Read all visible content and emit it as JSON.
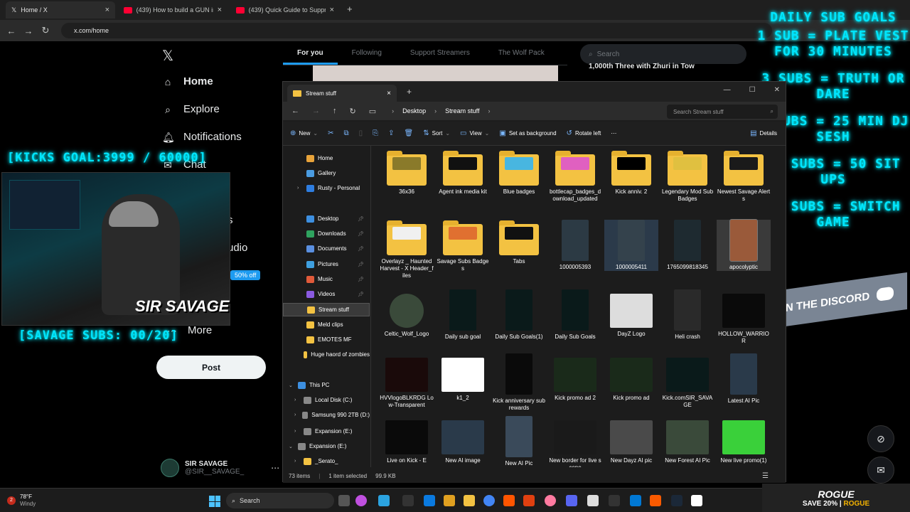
{
  "browser": {
    "tabs": [
      {
        "title": "Home / X",
        "active": true
      },
      {
        "title": "(439) How to build a GUN in g",
        "active": false
      },
      {
        "title": "(439) Quick Guide to Suppress",
        "active": false
      }
    ],
    "new_tab": "+",
    "url": "x.com/home"
  },
  "x": {
    "nav": [
      {
        "label": "Home",
        "icon": "home-icon"
      },
      {
        "label": "Explore",
        "icon": "search-icon"
      },
      {
        "label": "Notifications",
        "icon": "bell-icon"
      },
      {
        "label": "Chat",
        "icon": "mail-icon"
      },
      {
        "label": "More",
        "icon": "more-icon"
      }
    ],
    "nav_partial_1": "s",
    "nav_partial_2": "udio",
    "post_label": "Post",
    "discount": "50% off",
    "profile": {
      "name": "SIR SAVAGE",
      "handle": "@SIR__SAVAGE_"
    },
    "feed_tabs": [
      "For you",
      "Following",
      "Support Streamers",
      "The Wolf Pack"
    ],
    "search_placeholder": "Search",
    "trend_title": "1,000th Three with Zhuri in Tow"
  },
  "overlay": {
    "goals": [
      "DAILY SUB GOALS",
      "1 SUB = PLATE VEST FOR 30 MINUTES",
      "3 SUBS = TRUTH OR DARE",
      "5 SUBS = 25 MIN DJ SESH",
      "10 SUBS = 50 SIT UPS",
      "20 SUBS = SWITCH GAME"
    ],
    "kicks_goal": "[KICKS GOAL:3999 / 60000]",
    "savage_subs": "[SAVAGE SUBS: 00/20]",
    "cam_name": "SIR SAVAGE",
    "discord": "JOIN THE DISCORD",
    "rogue": "ROGUE",
    "rogue_save": "SAVE 20%",
    "rogue_code": "ROGUE"
  },
  "explorer": {
    "tab_title": "Stream stuff",
    "breadcrumb": [
      "Desktop",
      "Stream stuff"
    ],
    "search_placeholder": "Search Stream stuff",
    "toolbar": [
      "New",
      "Sort",
      "View",
      "Set as background",
      "Rotate left",
      "Details"
    ],
    "nav": [
      {
        "label": "Home",
        "color": "#e8a33a"
      },
      {
        "label": "Gallery",
        "color": "#4a9be0"
      },
      {
        "label": "Rusty - Personal",
        "color": "#2e7de0"
      },
      {
        "label": "Desktop",
        "color": "#3d8fe0"
      },
      {
        "label": "Downloads",
        "color": "#2fa35f"
      },
      {
        "label": "Documents",
        "color": "#5a8fe0"
      },
      {
        "label": "Pictures",
        "color": "#3fa0e0"
      },
      {
        "label": "Music",
        "color": "#e05a3a"
      },
      {
        "label": "Videos",
        "color": "#8a5ae0"
      },
      {
        "label": "Stream stuff",
        "color": "#f3c242"
      },
      {
        "label": "Meld clips",
        "color": "#f3c242"
      },
      {
        "label": "EMOTES MF",
        "color": "#f3c242"
      },
      {
        "label": "Huge haord of zombies",
        "color": "#f3c242"
      },
      {
        "label": "This PC",
        "color": "#3d8fe0"
      },
      {
        "label": "Local Disk (C:)",
        "color": "#888888"
      },
      {
        "label": "Samsung 990 2TB (D:)",
        "color": "#888888"
      },
      {
        "label": "Expansion (E:)",
        "color": "#888888"
      },
      {
        "label": "Expansion (E:)",
        "color": "#888888"
      },
      {
        "label": "_Serato_",
        "color": "#f3c242"
      }
    ],
    "files": [
      {
        "name": "36x36",
        "kind": "folder",
        "color": "#8a7a2a"
      },
      {
        "name": "Agent ink media kit",
        "kind": "folder",
        "color": "#111111"
      },
      {
        "name": "Blue badges",
        "kind": "folder",
        "color": "#48b6e0"
      },
      {
        "name": "bottlecap_badges_download_updated",
        "kind": "folder",
        "color": "#e060c0"
      },
      {
        "name": "Kick anniv. 2",
        "kind": "folder",
        "color": "#000000"
      },
      {
        "name": "Legendary Mod Sub Badges",
        "kind": "folder",
        "color": "#e0c040"
      },
      {
        "name": "Newest Savage Alerts",
        "kind": "folder",
        "color": "#1a1a1a"
      },
      {
        "name": "Overlayz _ Haunted Harvest - X Header_files",
        "kind": "folder",
        "color": "#f0f0f0"
      },
      {
        "name": "Savage Subs Badges",
        "kind": "folder",
        "color": "#e07030"
      },
      {
        "name": "Tabs",
        "kind": "folder",
        "color": "#111111"
      },
      {
        "name": "1000005393",
        "kind": "pic",
        "color": "#2c3a44"
      },
      {
        "name": "1000005411",
        "kind": "pic",
        "color": "#34424c"
      },
      {
        "name": "1765099818345",
        "kind": "pic",
        "color": "#1e2a30"
      },
      {
        "name": "apocolyptic",
        "kind": "pic",
        "color": "#9a5a3a"
      },
      {
        "name": "Celtic_Wolf_Logo",
        "kind": "round",
        "color": "#3a4a3a"
      },
      {
        "name": "Daily sub goal",
        "kind": "pic",
        "color": "#0a1a1a"
      },
      {
        "name": "Daily Sub Goals(1)",
        "kind": "pic",
        "color": "#0a1a1a"
      },
      {
        "name": "Daily Sub Goals",
        "kind": "pic",
        "color": "#0a1a1a"
      },
      {
        "name": "DayZ Logo",
        "kind": "wpic",
        "color": "#dddddd"
      },
      {
        "name": "Heli crash",
        "kind": "pic",
        "color": "#2a2a2a"
      },
      {
        "name": "HOLLOW_WARRIOR",
        "kind": "wpic",
        "color": "#0a0a0a"
      },
      {
        "name": "HVVlogoBLKRDG Low-Transparent",
        "kind": "wpic",
        "color": "#1a0a0a"
      },
      {
        "name": "k1_2",
        "kind": "wpic",
        "color": "#ffffff"
      },
      {
        "name": "Kick anniversary sub rewards",
        "kind": "pic",
        "color": "#0a0a0a"
      },
      {
        "name": "Kick promo ad 2",
        "kind": "wpic",
        "color": "#1a2a1a"
      },
      {
        "name": "Kick promo ad",
        "kind": "wpic",
        "color": "#1a2a1a"
      },
      {
        "name": "Kick.comSIR_SAVAGE",
        "kind": "wpic",
        "color": "#0a1a1a"
      },
      {
        "name": "Latest AI Pic",
        "kind": "pic",
        "color": "#2a3a4a"
      },
      {
        "name": "Live on Kick - E",
        "kind": "wpic",
        "color": "#0a0a0a"
      },
      {
        "name": "New AI image",
        "kind": "wpic",
        "color": "#2a3a4a"
      },
      {
        "name": "New AI Pic",
        "kind": "pic",
        "color": "#3a4a5a"
      },
      {
        "name": "New border for live scene",
        "kind": "wpic",
        "color": "#1a1a1a"
      },
      {
        "name": "New Dayz AI pic",
        "kind": "wpic",
        "color": "#4a4a4a"
      },
      {
        "name": "New Forest AI Pic",
        "kind": "wpic",
        "color": "#3a4a3a"
      },
      {
        "name": "New live promo(1)",
        "kind": "wpic",
        "color": "#3ad03a"
      }
    ],
    "status": {
      "count": "73 items",
      "selected": "1 item selected",
      "size": "99.9 KB"
    }
  },
  "taskbar": {
    "temp": "78°F",
    "condition": "Windy",
    "badge": "2",
    "search": "Search"
  }
}
